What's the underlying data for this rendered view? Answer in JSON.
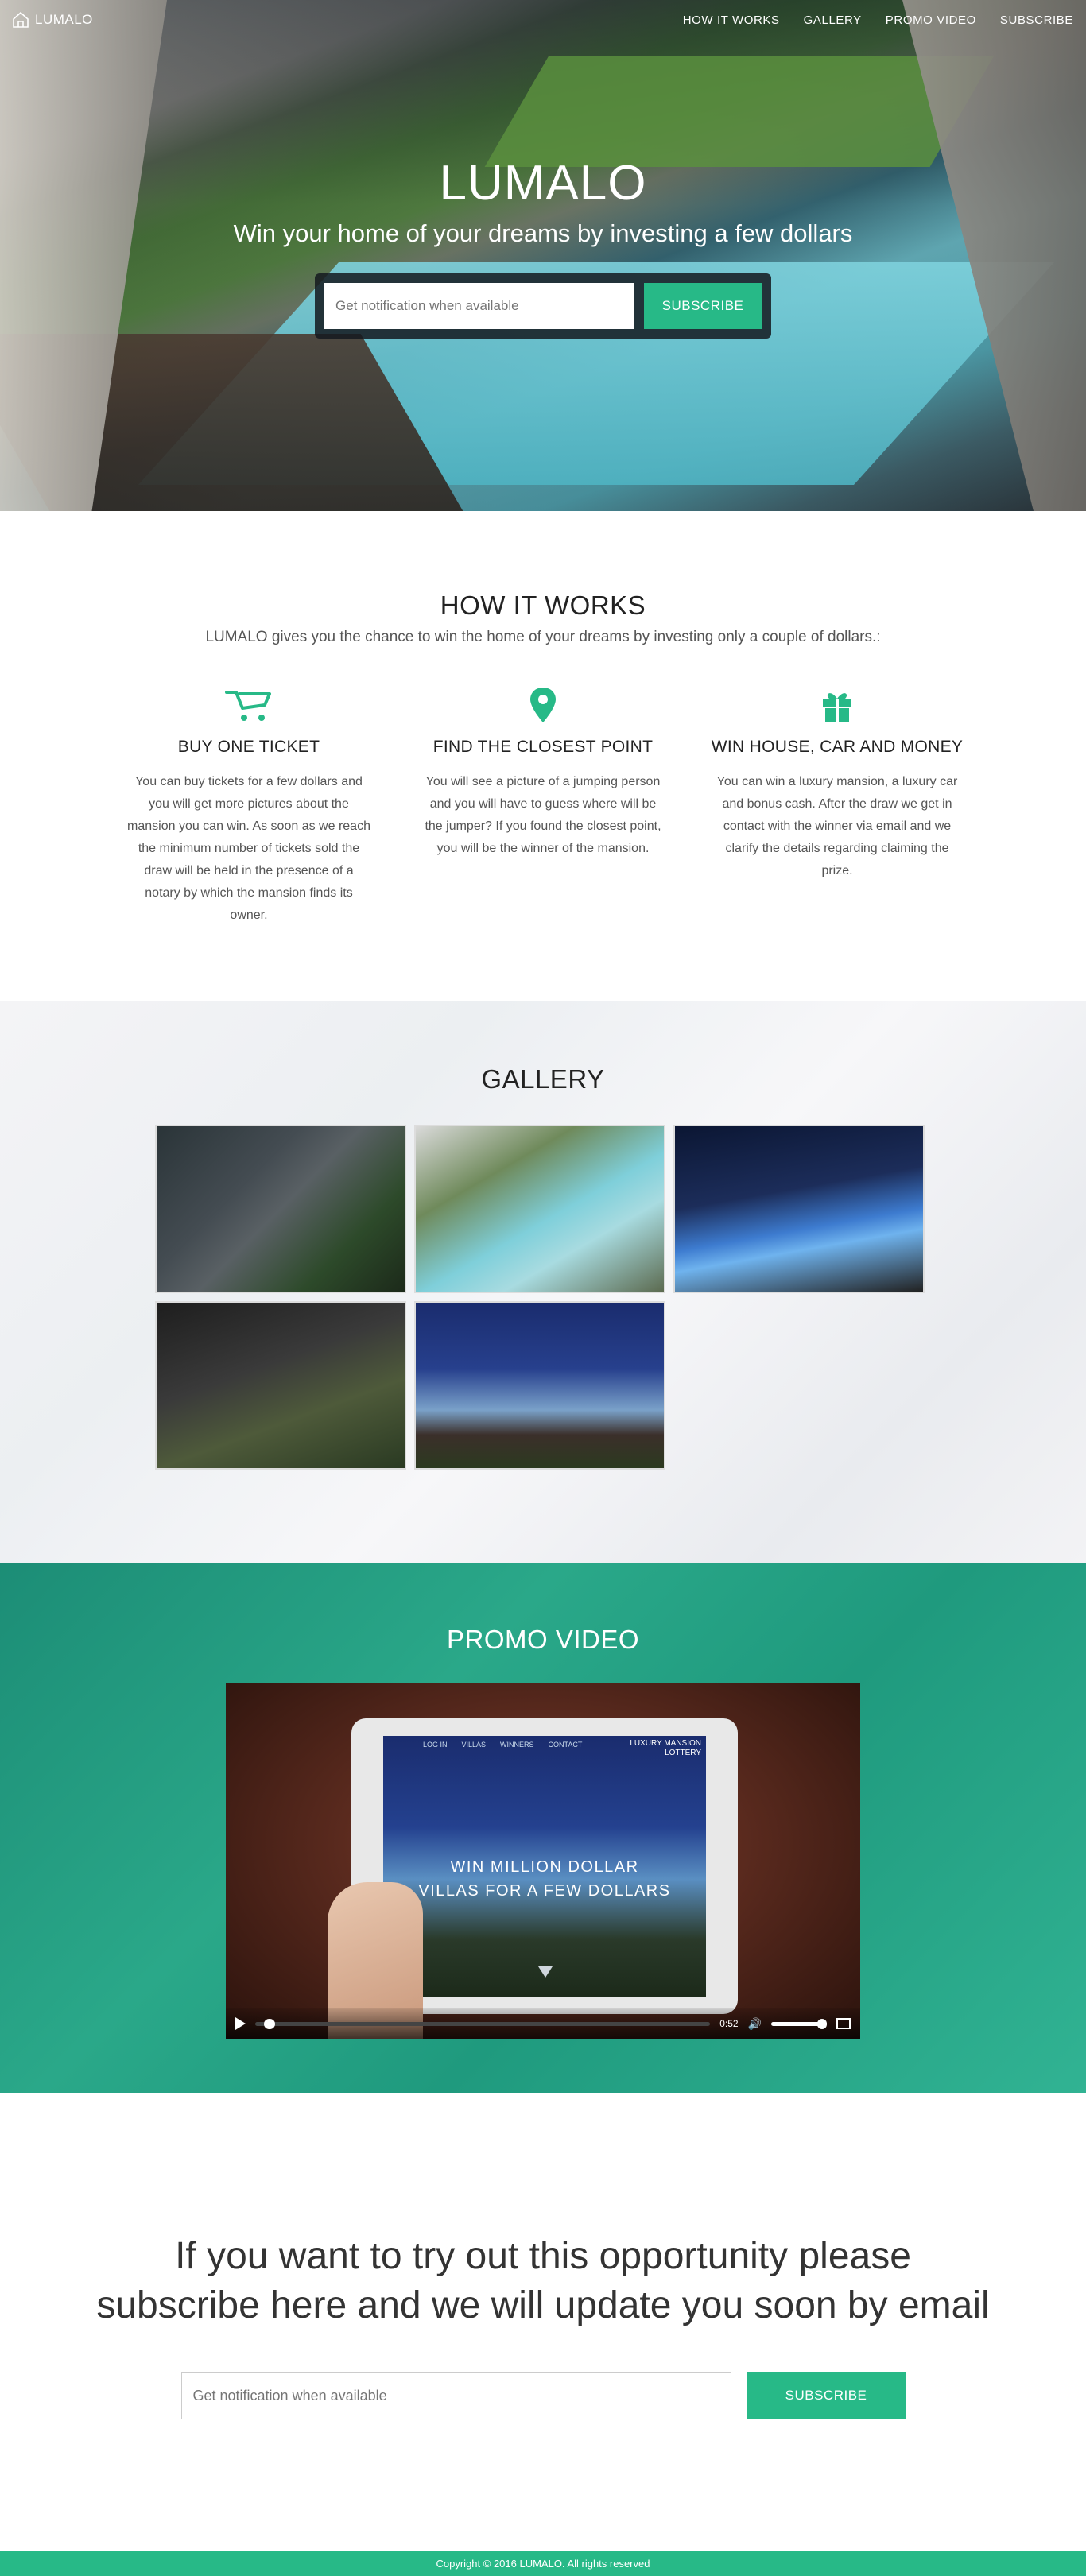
{
  "nav": {
    "brand": "LUMALO",
    "items": [
      "HOW IT WORKS",
      "GALLERY",
      "PROMO VIDEO",
      "SUBSCRIBE"
    ]
  },
  "hero": {
    "title": "LUMALO",
    "subtitle": "Win your home of your dreams by investing a few dollars",
    "input_placeholder": "Get notification when available",
    "button_label": "SUBSCRIBE"
  },
  "how": {
    "title": "HOW IT WORKS",
    "intro": "LUMALO gives you the chance to win the home of your dreams by investing only a couple of dollars.:",
    "features": [
      {
        "icon": "cart-icon",
        "title": "BUY ONE TICKET",
        "text": "You can buy tickets for a few dollars and you will get more pictures about the mansion you can win. As soon as we reach the minimum number of tickets sold the draw will be held in the presence of a notary by which the mansion finds its owner."
      },
      {
        "icon": "map-pin-icon",
        "title": "FIND THE CLOSEST POINT",
        "text": "You will see a picture of a jumping person and you will have to guess where will be the jumper? If you found the closest point, you will be the winner of the mansion."
      },
      {
        "icon": "gift-icon",
        "title": "WIN HOUSE, CAR AND MONEY",
        "text": "You can win a luxury mansion, a luxury car and bonus cash. After the draw we get in contact with the winner via email and we clarify the details regarding claiming the prize."
      }
    ]
  },
  "gallery": {
    "title": "GALLERY"
  },
  "promo": {
    "title": "PROMO VIDEO",
    "video": {
      "screen_nav": [
        "LOG IN",
        "VILLAS",
        "WINNERS",
        "CONTACT"
      ],
      "screen_logo_line1": "LUXURY MANSION",
      "screen_logo_line2": "LOTTERY",
      "screen_text_line1": "WIN MILLION DOLLAR",
      "screen_text_line2": "VILLAS FOR A FEW DOLLARS",
      "time": "0:52",
      "progress": 0.02,
      "volume": 1.0
    }
  },
  "subscribe": {
    "heading_line1": "If you want to try out this opportunity please",
    "heading_line2": "subscribe here and we will update you soon by email",
    "input_placeholder": "Get notification when available",
    "button_label": "SUBSCRIBE"
  },
  "footer": {
    "text": "Copyright © 2016 LUMALO. All rights reserved"
  },
  "colors": {
    "accent": "#27b987",
    "promo_bg": "#1f9a7e",
    "text": "#333333"
  }
}
